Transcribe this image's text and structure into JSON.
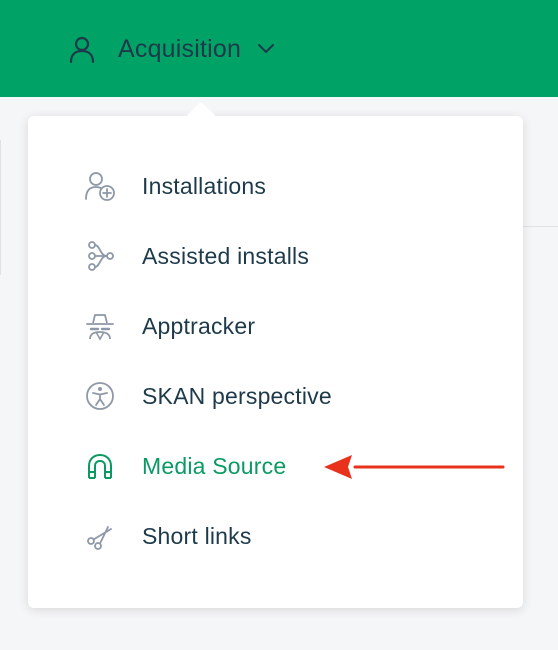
{
  "header": {
    "title": "Acquisition",
    "user_icon": "user-icon",
    "dropdown_icon": "chevron-down-icon",
    "background_color": "#00a365"
  },
  "menu": {
    "items": [
      {
        "label": "Installations",
        "icon": "user-plus-icon",
        "active": false
      },
      {
        "label": "Assisted installs",
        "icon": "branch-icon",
        "active": false
      },
      {
        "label": "Apptracker",
        "icon": "spy-icon",
        "active": false
      },
      {
        "label": "SKAN perspective",
        "icon": "accessibility-icon",
        "active": false
      },
      {
        "label": "Media Source",
        "icon": "magnet-icon",
        "active": true
      },
      {
        "label": "Short links",
        "icon": "scissors-icon",
        "active": false
      }
    ],
    "active_color": "#0a9a63",
    "text_color": "#1e3a4a",
    "icon_color": "#8e98a8"
  },
  "annotation": {
    "arrow_color": "#e8321c",
    "points_to": "Media Source"
  }
}
